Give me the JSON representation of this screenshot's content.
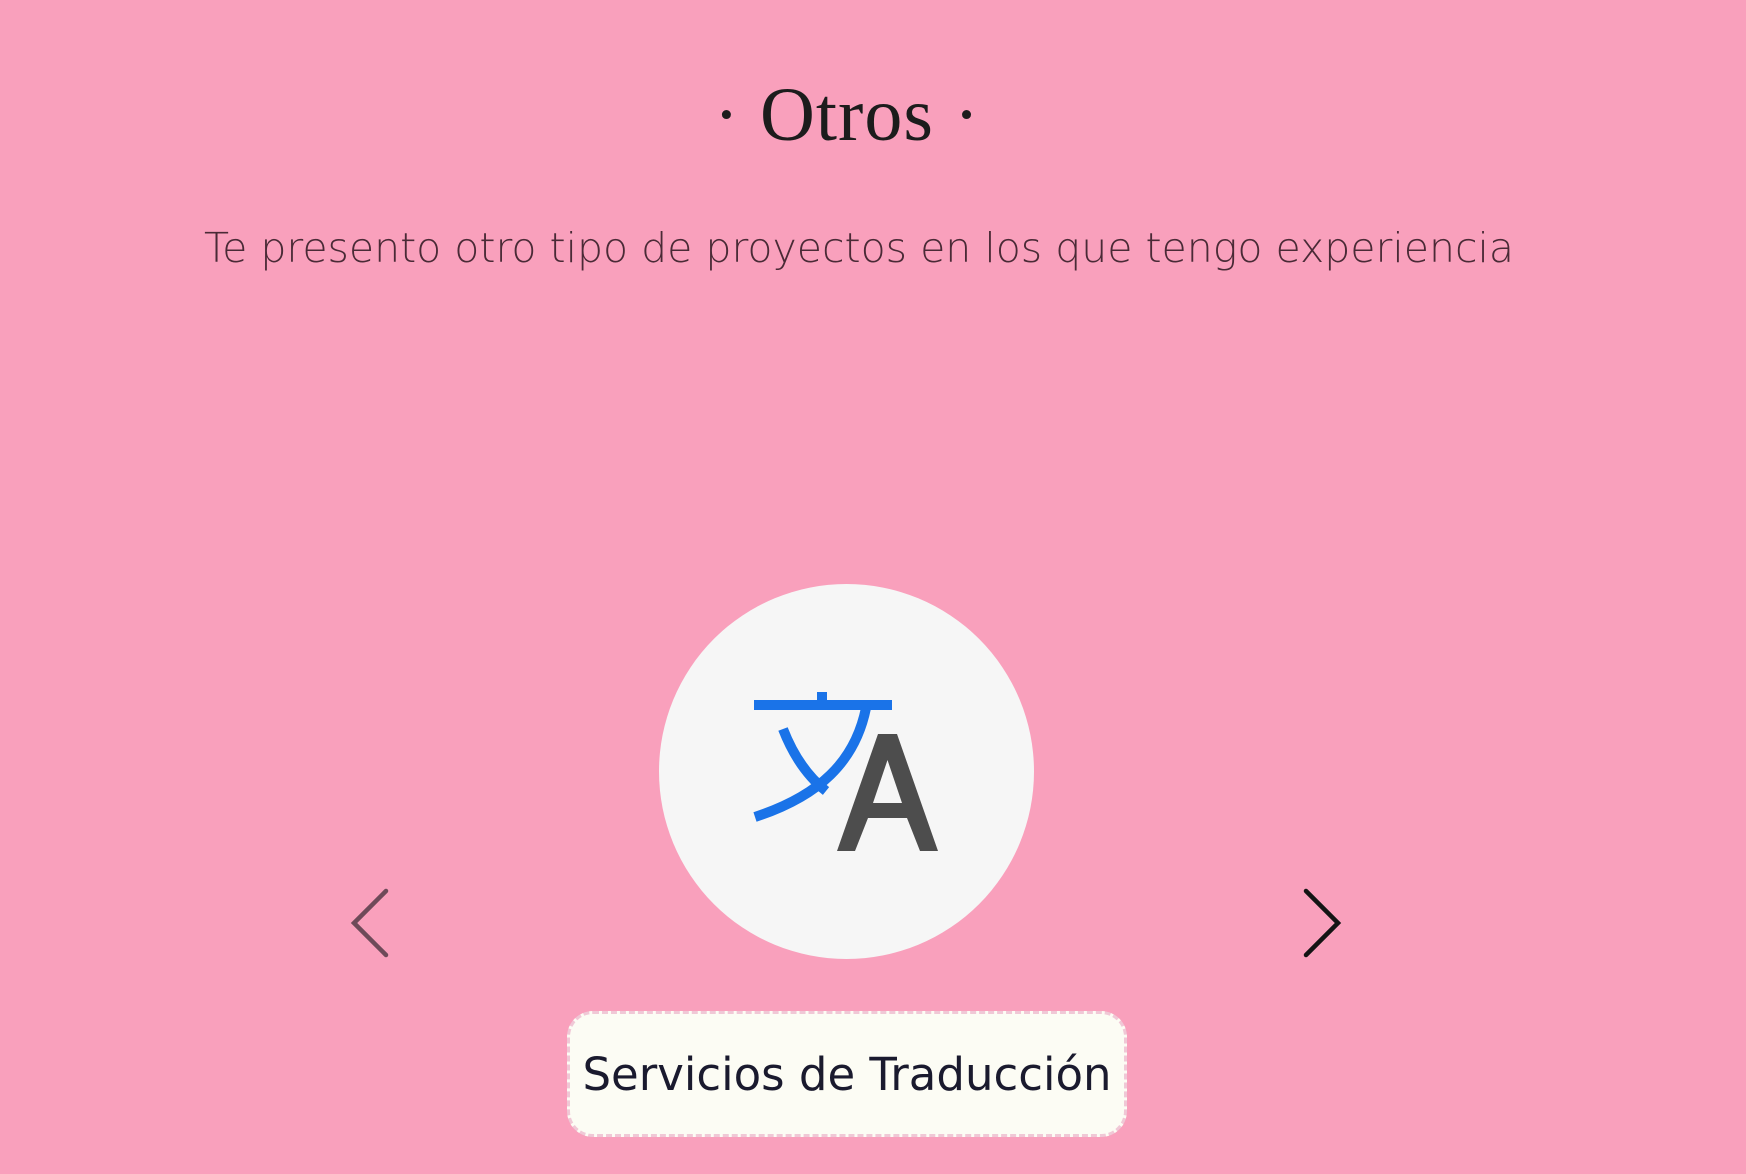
{
  "section": {
    "title": "· Otros ·",
    "subtitle": "Te presento otro tipo de proyectos en los que tengo experiencia"
  },
  "carousel": {
    "current_item": {
      "icon": "translate-icon",
      "label": "Servicios de Traducción"
    },
    "prev_icon": "chevron-left-icon",
    "next_icon": "chevron-right-icon"
  },
  "colors": {
    "background": "#f9a0bc",
    "icon_blue": "#1a73e8",
    "icon_gray": "#4d4d4d",
    "circle": "#f6f6f6"
  }
}
